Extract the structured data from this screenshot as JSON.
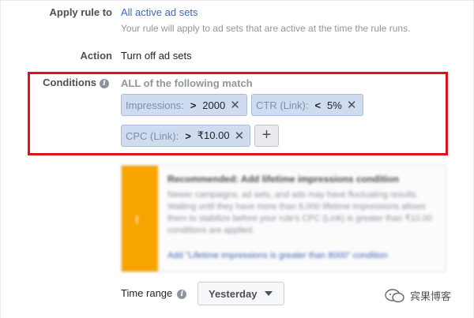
{
  "apply_rule": {
    "label": "Apply rule to",
    "value": "All active ad sets",
    "help": "Your rule will apply to ad sets that are active at the time the rule runs."
  },
  "action": {
    "label": "Action",
    "value": "Turn off ad sets"
  },
  "conditions": {
    "label": "Conditions",
    "info_icon": "info-icon",
    "match_text": "ALL of the following match",
    "items": [
      {
        "metric": "Impressions:",
        "operator": ">",
        "value": "2000"
      },
      {
        "metric": "CTR (Link):",
        "operator": "<",
        "value": "5%"
      },
      {
        "metric": "CPC (Link):",
        "operator": ">",
        "value": "₹10.00"
      }
    ],
    "remove_icon": "close-icon",
    "add_label": "+",
    "highlight_color": "#e0111d"
  },
  "recommendation": {
    "title": "Recommended: Add lifetime impressions condition",
    "body": "Newer campaigns, ad sets, and ads may have fluctuating results. Waiting until they have more than 8,000 lifetime impressions allows them to stabilize before your rule's CPC (Link) is greater than ₹10.00 conditions are applied.",
    "link": "Add \"Lifetime impressions is greater than 8000\" condition",
    "accent_color": "#f7a400"
  },
  "time_range": {
    "label": "Time range",
    "value": "Yesterday"
  },
  "watermark": {
    "text": "宾果博客"
  }
}
